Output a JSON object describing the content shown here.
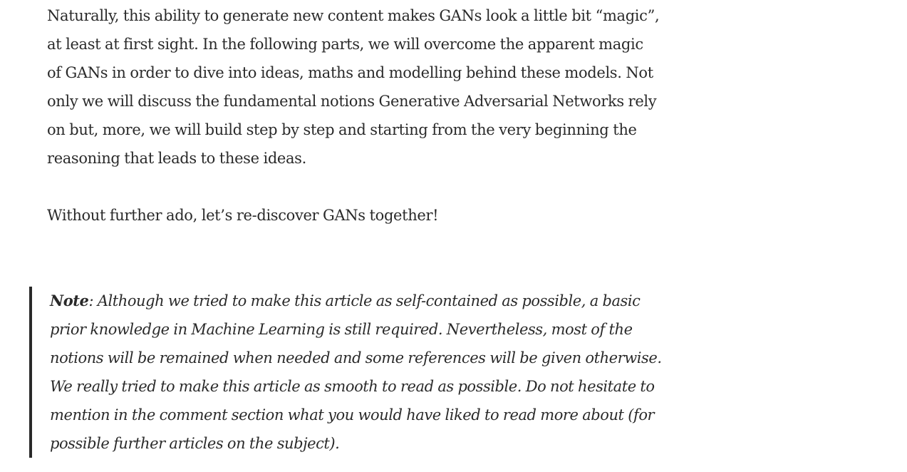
{
  "article": {
    "paragraphs": [
      "Naturally, this ability to generate new content makes GANs look a little bit “magic”, at least at first sight. In the following parts, we will overcome the apparent magic of GANs in order to dive into ideas, maths and modelling behind these models. Not only we will discuss the fundamental notions Generative Adversarial Networks rely on but, more, we will build step by step and starting from the very beginning the reasoning that leads to these ideas.",
      "Without further ado, let’s re-discover GANs together!"
    ],
    "note": {
      "label": "Note",
      "text": ": Although we tried to make this article as self-contained as possible, a basic prior knowledge in Machine Learning is still required. Nevertheless, most of the notions will be remained when needed and some references will be given otherwise. We really tried to make this article as smooth to read as possible. Do not hesitate to mention in the comment section what you would have liked to read more about (for possible further articles on the subject)."
    }
  }
}
